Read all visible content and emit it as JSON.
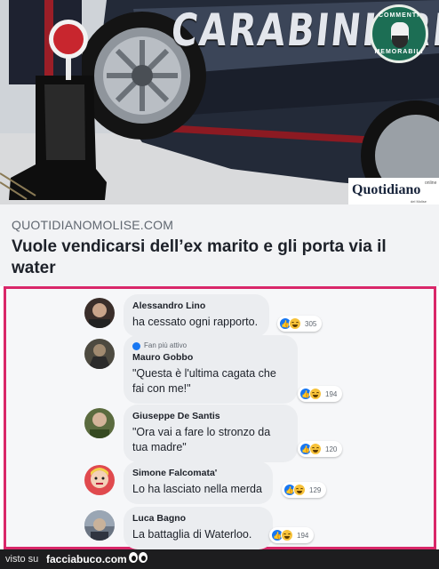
{
  "hero": {
    "car_lettering": "CARABINIERI",
    "badge_top": "COMMENTI",
    "badge_bottom": "MEMORABILI",
    "newspaper_logo": "Quotidiano",
    "newspaper_online": "online",
    "newspaper_sub": "del Molise"
  },
  "link": {
    "domain": "QUOTIDIANOMOLISE.COM",
    "headline": "Vuole vendicarsi dell’ex marito e gli porta via il water"
  },
  "comments": [
    {
      "author": "Alessandro Lino",
      "text": "ha cessato ogni rapporto.",
      "reactions": "305",
      "badge": ""
    },
    {
      "author": "Mauro Gobbo",
      "text": "\"Questa è l'ultima cagata che fai con me!\"",
      "reactions": "194",
      "badge": "Fan più attivo"
    },
    {
      "author": "Giuseppe De Santis",
      "text": "\"Ora vai a fare lo stronzo da tua madre\"",
      "reactions": "120",
      "badge": ""
    },
    {
      "author": "Simone Falcomata'",
      "text": "Lo ha lasciato nella merda",
      "reactions": "129",
      "badge": ""
    },
    {
      "author": "Luca Bagno",
      "text": "La battaglia di Waterloo.",
      "reactions": "194",
      "badge": ""
    }
  ],
  "footer": {
    "visto": "visto su",
    "site": "facciabuco.com"
  },
  "colors": {
    "frame": "#d92769",
    "like": "#1877f2",
    "haha": "#f7c23a",
    "badge_green": "#1c6e54"
  }
}
